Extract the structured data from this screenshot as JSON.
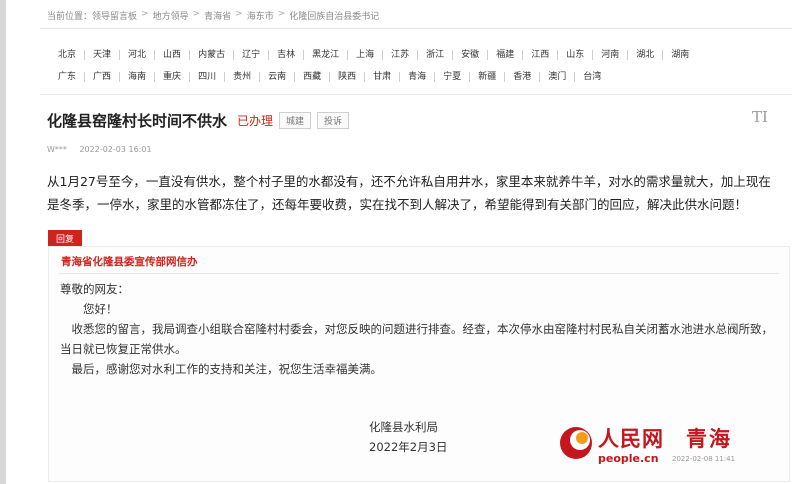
{
  "breadcrumb": {
    "prefix": "当前位置：",
    "items": [
      "领导留言板",
      "地方领导",
      "青海省",
      "海东市",
      "化隆回族自治县委书记"
    ]
  },
  "regions": {
    "row1": [
      "北京",
      "天津",
      "河北",
      "山西",
      "内蒙古",
      "辽宁",
      "吉林",
      "黑龙江",
      "上海",
      "江苏",
      "浙江",
      "安徽",
      "福建",
      "江西",
      "山东",
      "河南",
      "湖北",
      "湖南"
    ],
    "row2": [
      "广东",
      "广西",
      "海南",
      "重庆",
      "四川",
      "贵州",
      "云南",
      "西藏",
      "陕西",
      "甘肃",
      "青海",
      "宁夏",
      "新疆",
      "香港",
      "澳门",
      "台湾"
    ]
  },
  "message": {
    "title": "化隆县窑隆村长时间不供水",
    "status": "已办理",
    "tags": [
      "城建",
      "投诉"
    ],
    "font_icon": "TI",
    "author": "W***",
    "date": "2022-02-03 16:01",
    "content": "从1月27号至今，一直没有供水，整个村子里的水都没有，还不允许私自用井水，家里本来就养牛羊，对水的需求量就大，加上现在是冬季，一停水，家里的水管都冻住了，还每年要收费，实在找不到人解决了，希望能得到有关部门的回应，解决此供水问题！"
  },
  "reply": {
    "badge": "回复",
    "from": "青海省化隆县委宣传部网信办",
    "greeting": "尊敬的网友：",
    "hello": "您好！",
    "body": "收悉您的留言，我局调查小组联合窑隆村村委会，对您反映的问题进行排查。经查，本次停水由窑隆村村民私自关闭蓄水池进水总阀所致，当日就已恢复正常供水。",
    "closing": "最后，感谢您对水利工作的支持和关注，祝您生活幸福美满。",
    "signature": "化隆县水利局",
    "sign_date": "2022年2月3日"
  },
  "watermark": {
    "brand": "人民网",
    "province": "青海",
    "url": "people.cn",
    "time": "2022-02-08 11:41"
  },
  "colors": {
    "accent": "#d0231f",
    "brand": "#c4161c"
  }
}
